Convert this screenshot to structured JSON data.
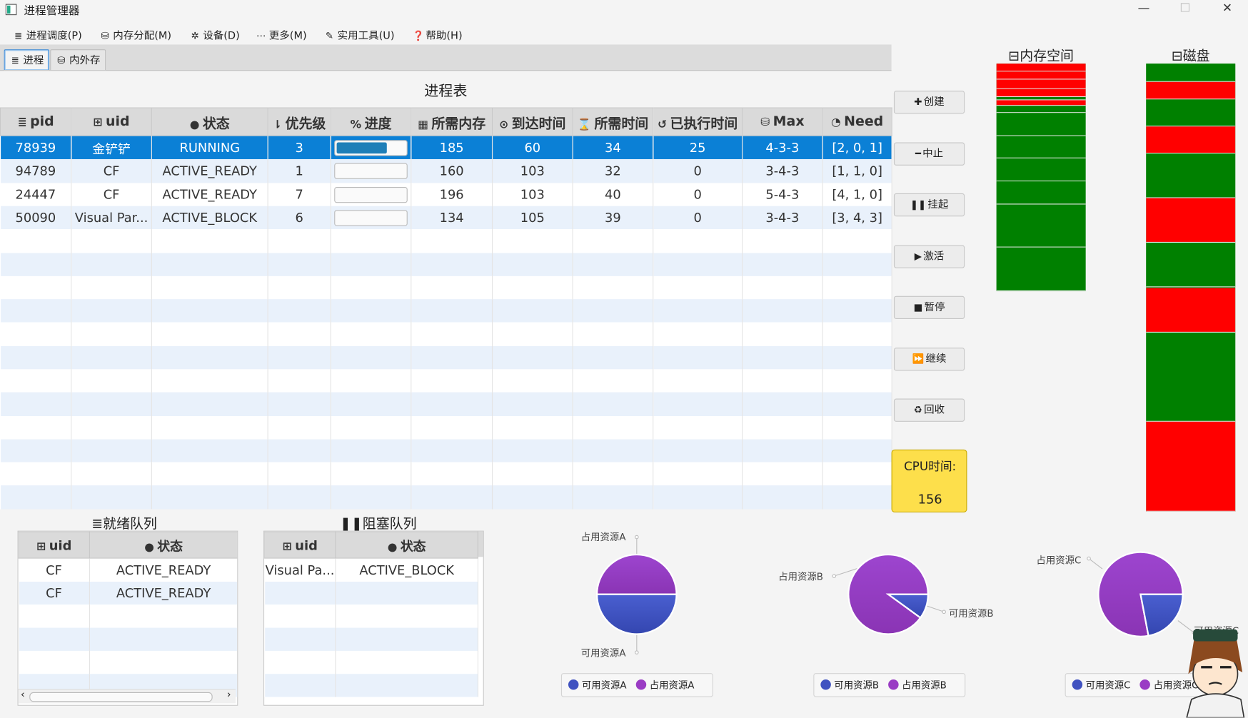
{
  "window": {
    "title": "进程管理器",
    "minimize": "—",
    "maximize": "☐",
    "close": "✕"
  },
  "menu": [
    {
      "label": "进程调度(P)",
      "icon": "≣"
    },
    {
      "label": "内存分配(M)",
      "icon": "⛁"
    },
    {
      "label": "设备(D)",
      "icon": "✲"
    },
    {
      "label": "更多(M)",
      "icon": "⋯"
    },
    {
      "label": "实用工具(U)",
      "icon": "✎"
    },
    {
      "label": "帮助(H)",
      "icon": "❓"
    }
  ],
  "tabs": [
    {
      "label": "进程",
      "icon": "≣",
      "active": true
    },
    {
      "label": "内外存",
      "icon": "⛁",
      "active": false
    }
  ],
  "process_table": {
    "title": "进程表",
    "columns": [
      {
        "label": "pid",
        "icon": "≣"
      },
      {
        "label": "uid",
        "icon": "⊞"
      },
      {
        "label": "状态",
        "icon": "●"
      },
      {
        "label": "优先级",
        "icon": "⇂"
      },
      {
        "label": "进度",
        "icon": "%"
      },
      {
        "label": "所需内存",
        "icon": "▦"
      },
      {
        "label": "到达时间",
        "icon": "⊙"
      },
      {
        "label": "所需时间",
        "icon": "⌛"
      },
      {
        "label": "已执行时间",
        "icon": "↺"
      },
      {
        "label": "Max",
        "icon": "⛁"
      },
      {
        "label": "Need",
        "icon": "◔"
      }
    ],
    "rows": [
      {
        "pid": "78939",
        "uid": "金铲铲",
        "state": "RUNNING",
        "priority": "3",
        "progress": 0.735,
        "memory": "185",
        "arrival": "60",
        "required": "34",
        "executed": "25",
        "max": "4-3-3",
        "need": "[2, 0, 1]",
        "selected": true
      },
      {
        "pid": "94789",
        "uid": "CF",
        "state": "ACTIVE_READY",
        "priority": "1",
        "progress": 0,
        "memory": "160",
        "arrival": "103",
        "required": "32",
        "executed": "0",
        "max": "3-4-3",
        "need": "[1, 1, 0]",
        "selected": false
      },
      {
        "pid": "24447",
        "uid": "CF",
        "state": "ACTIVE_READY",
        "priority": "7",
        "progress": 0,
        "memory": "196",
        "arrival": "103",
        "required": "40",
        "executed": "0",
        "max": "5-4-3",
        "need": "[4, 1, 0]",
        "selected": false
      },
      {
        "pid": "50090",
        "uid": "Visual Par...",
        "state": "ACTIVE_BLOCK",
        "priority": "6",
        "progress": 0,
        "memory": "134",
        "arrival": "105",
        "required": "39",
        "executed": "0",
        "max": "3-4-3",
        "need": "[3, 4, 3]",
        "selected": false
      }
    ]
  },
  "actions": [
    {
      "label": "创建",
      "icon": "✚"
    },
    {
      "label": "中止",
      "icon": "━"
    },
    {
      "label": "挂起",
      "icon": "❚❚"
    },
    {
      "label": "激活",
      "icon": "▶"
    },
    {
      "label": "暂停",
      "icon": "■"
    },
    {
      "label": "继续",
      "icon": "⏩"
    },
    {
      "label": "回收",
      "icon": "♻"
    }
  ],
  "cpu": {
    "label": "CPU时间:",
    "value": "156"
  },
  "memory_space": {
    "title": "⊟内存空间",
    "colors": {
      "used": "#ff0000",
      "free": "#008000"
    },
    "segments": [
      {
        "status": "used",
        "share": 3.5
      },
      {
        "status": "used",
        "share": 3.5
      },
      {
        "status": "used",
        "share": 4
      },
      {
        "status": "used",
        "share": 3.5
      },
      {
        "status": "free",
        "share": 1.5
      },
      {
        "status": "used",
        "share": 2.5
      },
      {
        "status": "free",
        "share": 3
      },
      {
        "status": "free",
        "share": 10
      },
      {
        "status": "free",
        "share": 10
      },
      {
        "status": "free",
        "share": 10
      },
      {
        "status": "free",
        "share": 10
      },
      {
        "status": "free",
        "share": 19
      },
      {
        "status": "free",
        "share": 19
      }
    ]
  },
  "disk": {
    "title": "⊟磁盘",
    "segments": [
      {
        "status": "free",
        "share": 4
      },
      {
        "status": "used",
        "share": 4
      },
      {
        "status": "free",
        "share": 6
      },
      {
        "status": "used",
        "share": 6
      },
      {
        "status": "free",
        "share": 10
      },
      {
        "status": "used",
        "share": 10
      },
      {
        "status": "free",
        "share": 10
      },
      {
        "status": "used",
        "share": 10
      },
      {
        "status": "free",
        "share": 20
      },
      {
        "status": "used",
        "share": 20
      }
    ]
  },
  "ready_queue": {
    "title": "≣就绪队列",
    "columns": [
      {
        "label": "uid",
        "icon": "⊞"
      },
      {
        "label": "状态",
        "icon": "●"
      }
    ],
    "rows": [
      {
        "uid": "CF",
        "state": "ACTIVE_READY"
      },
      {
        "uid": "CF",
        "state": "ACTIVE_READY"
      }
    ],
    "scroll_left": "‹",
    "scroll_right": "›"
  },
  "block_queue": {
    "title": "❚❚阻塞队列",
    "columns": [
      {
        "label": "uid",
        "icon": "⊞"
      },
      {
        "label": "状态",
        "icon": "●"
      }
    ],
    "rows": [
      {
        "uid": "Visual Pa...",
        "state": "ACTIVE_BLOCK"
      }
    ]
  },
  "resource_pies": [
    {
      "occupied_label": "占用资源A",
      "available_label": "可用资源A",
      "occupied_share": 0.5,
      "available_share": 0.5,
      "legend": [
        "可用资源A",
        "占用资源A"
      ]
    },
    {
      "occupied_label": "占用资源B",
      "available_label": "可用资源B",
      "occupied_share": 0.9,
      "available_share": 0.1,
      "legend": [
        "可用资源B",
        "占用资源B"
      ]
    },
    {
      "occupied_label": "占用资源C",
      "available_label": "可用资源C",
      "occupied_share": 0.78,
      "available_share": 0.22,
      "legend": [
        "可用资源C",
        "占用资源C"
      ]
    }
  ],
  "colors": {
    "accent_blue": "#0b80d6",
    "cpu_yellow": "#fddf4b",
    "pie_available": "#4052c0",
    "pie_occupied": "#9a3cc4"
  }
}
